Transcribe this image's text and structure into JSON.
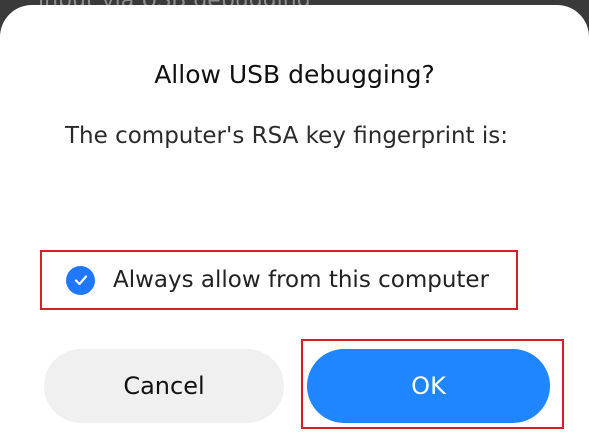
{
  "background": {
    "partial_text": "input via USB debugging"
  },
  "dialog": {
    "title": "Allow USB debugging?",
    "message": "The computer's RSA key fingerprint is:",
    "checkbox": {
      "label": "Always allow from this computer",
      "checked": true
    },
    "buttons": {
      "cancel": "Cancel",
      "ok": "OK"
    }
  },
  "colors": {
    "accent": "#1f86ff",
    "highlight": "#d61f2a"
  },
  "icons": {
    "checkbox": "check-icon"
  }
}
